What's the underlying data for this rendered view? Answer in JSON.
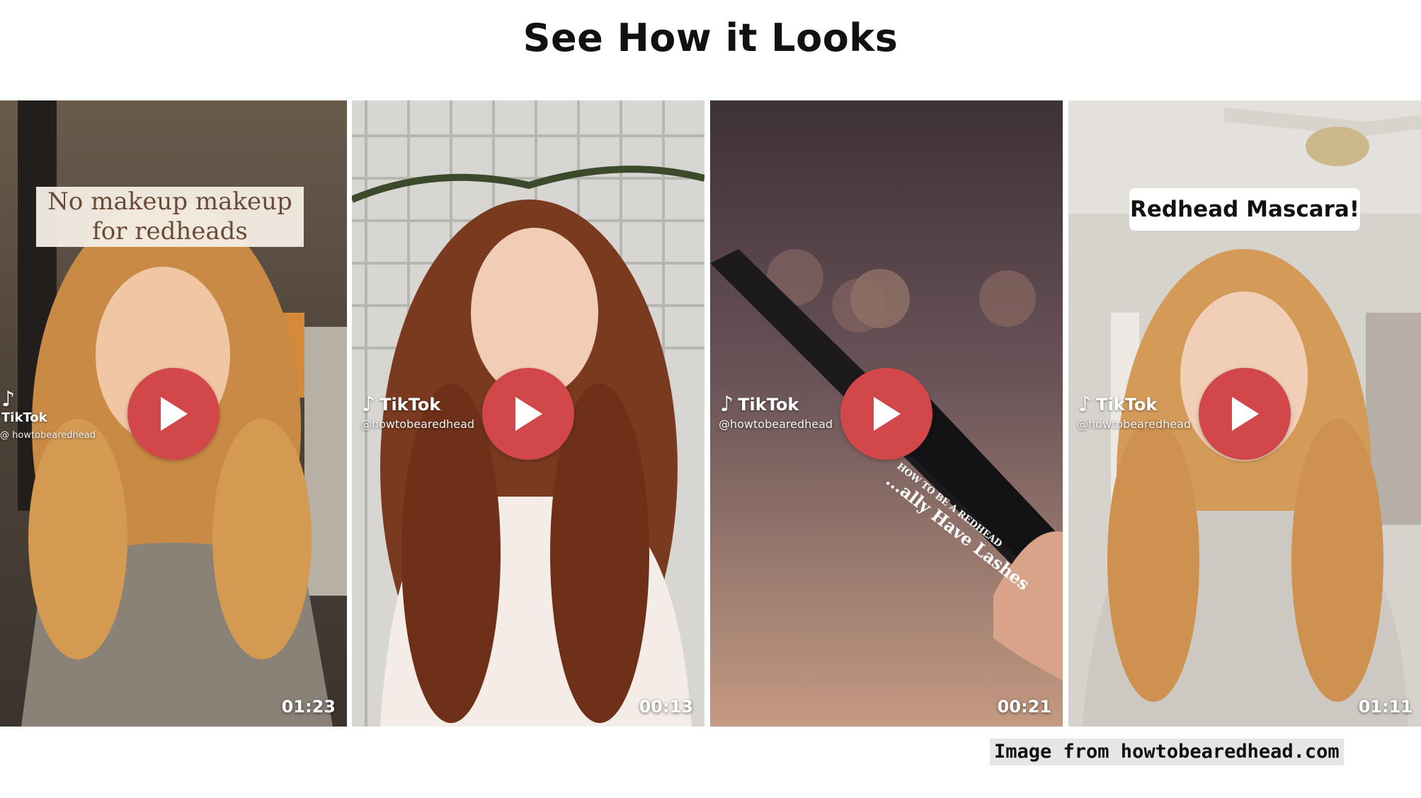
{
  "page": {
    "title": "See How it Looks",
    "credit": "Image from howtobearedhead.com"
  },
  "videos": [
    {
      "caption": "No makeup makeup for redheads",
      "brand": "TikTok",
      "handle": "@ howtobearedhead",
      "duration": "01:23"
    },
    {
      "caption": "",
      "brand": "TikTok",
      "handle": "@howtobearedhead",
      "duration": "00:13"
    },
    {
      "caption": "",
      "brand": "TikTok",
      "handle": "@howtobearedhead",
      "duration": "00:21",
      "product_text": "HOW TO BE A REDHEAD",
      "product_text_2": "...ally Have Lashes"
    },
    {
      "caption": "Redhead Mascara!",
      "brand": "TikTok",
      "handle": "@howtobearedhead",
      "duration": "01:11"
    }
  ],
  "colors": {
    "play_button": "#d2484a",
    "title_text": "#111111"
  },
  "icons": [
    "play-icon",
    "tiktok-icon"
  ]
}
